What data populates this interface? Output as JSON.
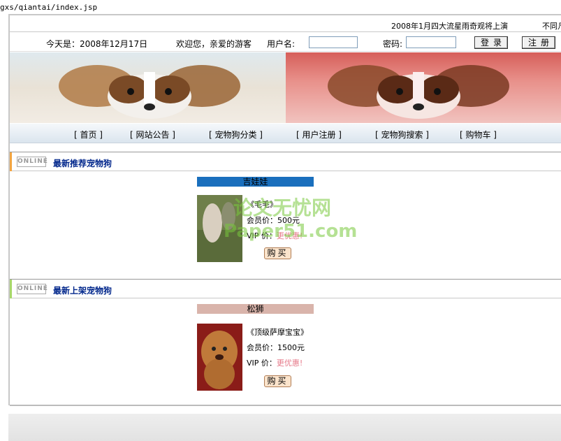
{
  "browser": {
    "url": "gxs/qiantai/index.jsp"
  },
  "marquee": {
    "text1": "2008年1月四大流星雨奇观将上演",
    "text2": "不同凡"
  },
  "login": {
    "date_label": "今天是：2008年12月17日",
    "welcome": "欢迎您，亲爱的游客",
    "username_label": "用户名:",
    "password_label": "密码:",
    "login_button": "登录",
    "register_button": "注册"
  },
  "nav": {
    "items": [
      "[ 首页 ]",
      "[ 网站公告 ]",
      "[ 宠物狗分类 ]",
      "[ 用户注册 ]",
      "[ 宠物狗搜索 ]",
      "[ 购物车 ]"
    ]
  },
  "sections": {
    "recommended": {
      "title": "最新推荐宠物狗",
      "category": "吉娃娃",
      "category_color": "#1a6fbd",
      "product_name": "《毛毛》",
      "member_price": "会员价：500元",
      "vip_label": "VIP 价：",
      "vip_value": "更优惠!",
      "buy_label": "购买"
    },
    "new": {
      "title": "最新上架宠物狗",
      "category": "松狮",
      "category_color": "#d9b4ab",
      "product_name": "《顶级萨摩宝宝》",
      "member_price": "会员价：1500元",
      "vip_label": "VIP 价：",
      "vip_value": "更优惠!",
      "buy_label": "购买"
    },
    "logo_text": "ONLINE"
  },
  "watermark": {
    "line1": "论文无忧网",
    "line2": "Paper51.com"
  },
  "colors": {
    "accent_blue": "#00268b",
    "vip_pink": "#e67a8a",
    "section1_bar": "#f4a540",
    "section2_bar": "#a8d86a"
  }
}
